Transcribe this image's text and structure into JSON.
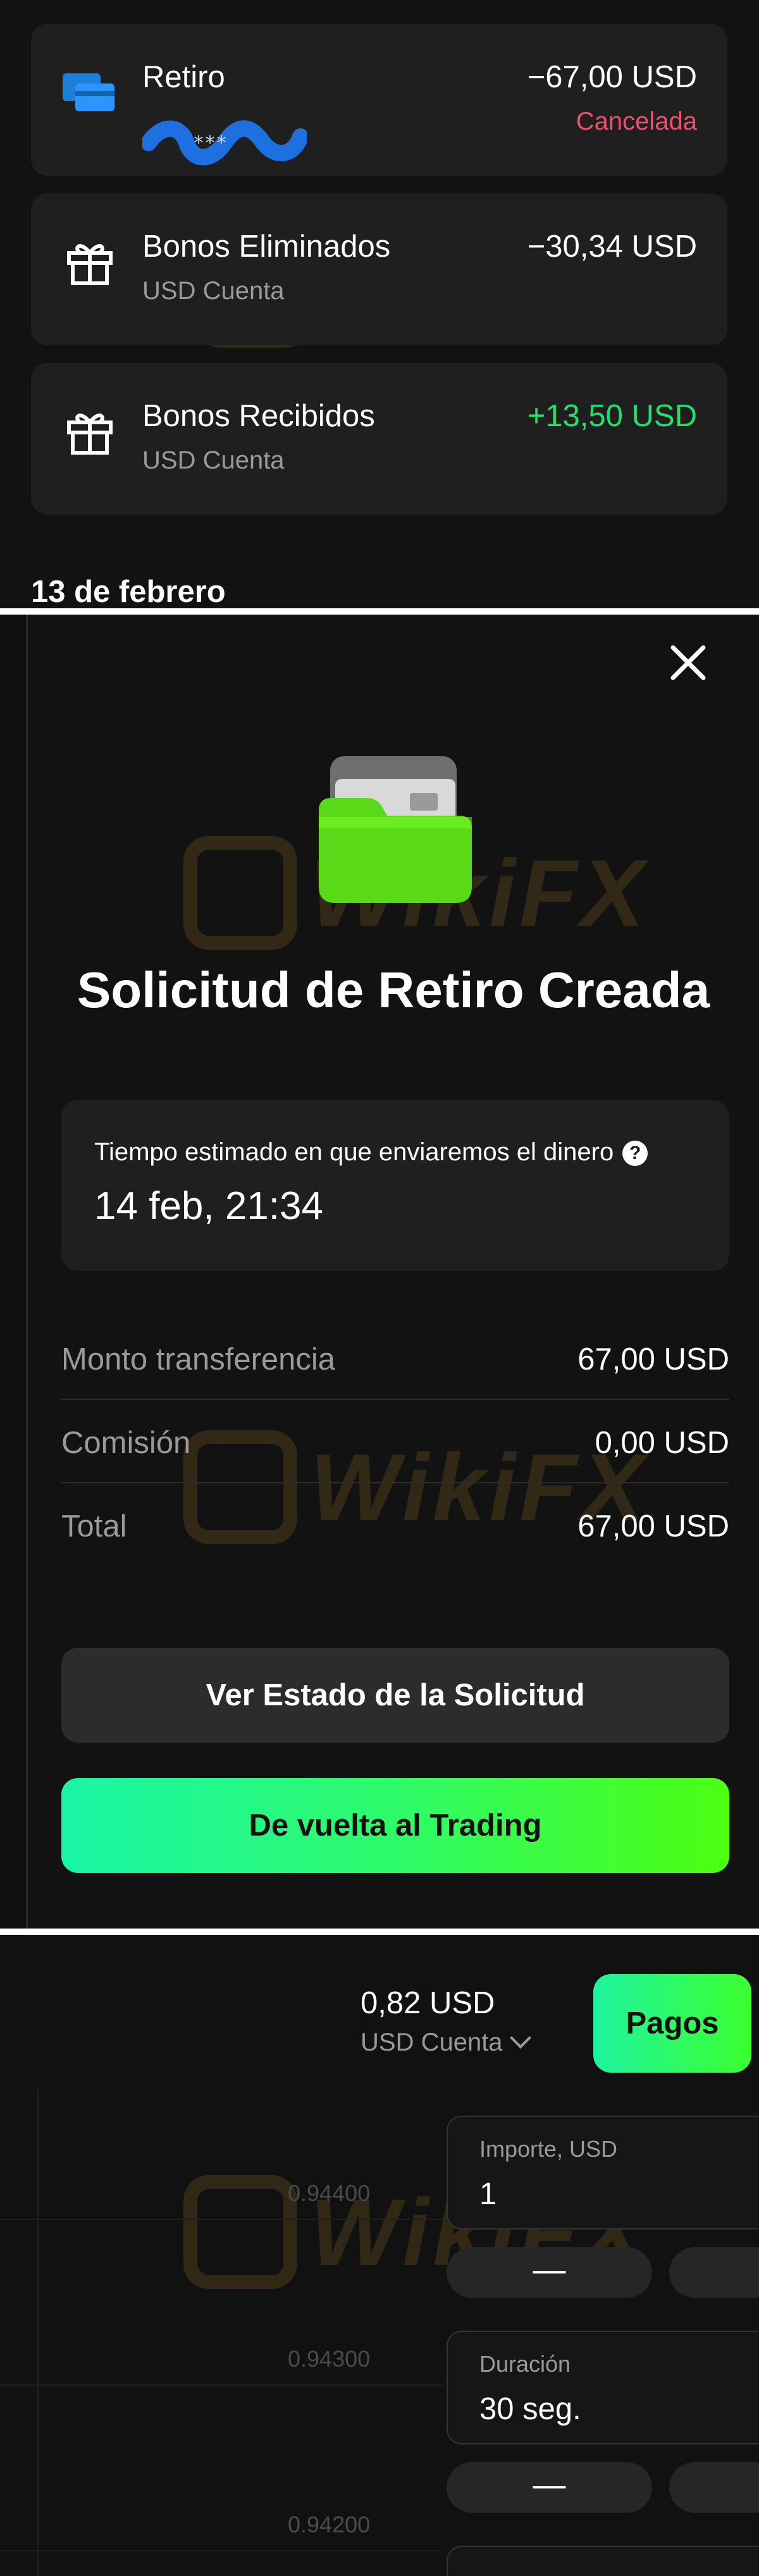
{
  "transactions": [
    {
      "title": "Retiro",
      "subtitle": "",
      "amount": "−67,00 USD",
      "status": "Cancelada",
      "icon": "card-icon",
      "amount_color": "#ffffff",
      "status_color": "#f0506e"
    },
    {
      "title": "Bonos Eliminados",
      "subtitle": "USD Cuenta",
      "amount": "−30,34 USD",
      "status": "",
      "icon": "gift-icon",
      "amount_color": "#ffffff"
    },
    {
      "title": "Bonos Recibidos",
      "subtitle": "USD Cuenta",
      "amount": "+13,50 USD",
      "status": "",
      "icon": "gift-icon",
      "amount_color": "#22e06b"
    }
  ],
  "date_heading": "13 de febrero",
  "modal": {
    "title": "Solicitud de Retiro Creada",
    "estimate_label": "Tiempo estimado en que enviaremos el dinero",
    "estimate_help": "?",
    "estimate_value": "14 feb, 21:34",
    "rows": [
      {
        "label": "Monto transferencia",
        "value": "67,00 USD"
      },
      {
        "label": "Comisión",
        "value": "0,00 USD"
      },
      {
        "label": "Total",
        "value": "67,00 USD"
      }
    ],
    "status_button": "Ver Estado de la Solicitud",
    "back_button": "De vuelta al Trading"
  },
  "watermark": "WikiFX",
  "trading": {
    "balance": "0,82 USD",
    "account": "USD Cuenta",
    "pagos_button": "Pagos",
    "prices": [
      "0.94400",
      "0.94300",
      "0.94200"
    ],
    "amount_label": "Importe, USD",
    "amount_value": "1",
    "duration_label": "Duración",
    "duration_value": "30 seg.",
    "minus": "—"
  },
  "colors": {
    "accent_green": "#3cff2e",
    "accent_teal": "#1ef4a0",
    "negative": "#f0506e",
    "positive": "#22e06b"
  }
}
